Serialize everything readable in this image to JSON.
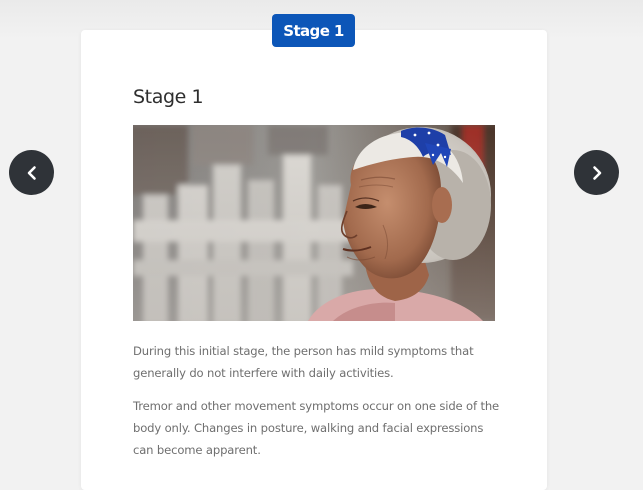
{
  "stage_tab": {
    "label": "Stage 1"
  },
  "card": {
    "title": "Stage 1",
    "paragraphs": [
      "During this initial stage, the person has mild symptoms that generally do not interfere with daily activities.",
      "Tremor and other movement symptoms occur on one side of the body only. Changes in posture, walking and facial expressions can become apparent."
    ]
  },
  "navigation": {
    "prev_icon": "chevron-left-icon",
    "next_icon": "chevron-right-icon"
  },
  "colors": {
    "accent": "#0c56b8",
    "nav_button": "#2f3338",
    "background": "#f2f2f2",
    "card": "#ffffff",
    "text": "#6f6f6f",
    "title": "#2e2e2e"
  }
}
